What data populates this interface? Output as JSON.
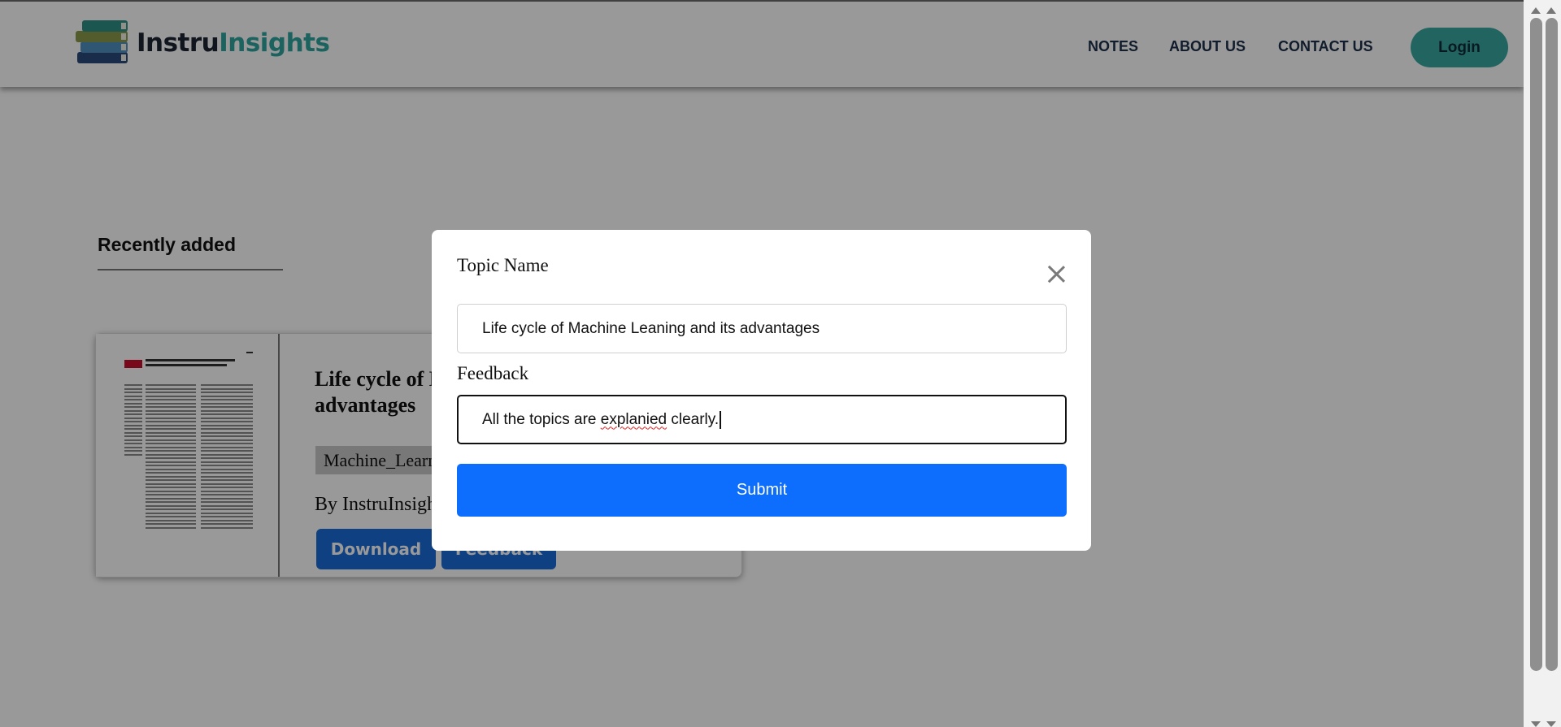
{
  "brand": {
    "name_part1": "Instru",
    "name_part2": "Insights"
  },
  "nav": {
    "notes": "NOTES",
    "about": "ABOUT US",
    "contact": "CONTACT US",
    "login": "Login"
  },
  "main": {
    "section_title": "Recently added",
    "card": {
      "title": "Life cycle of Machine Leaning and its advantages",
      "tag": "Machine_Learning",
      "author": "By InstruInsights",
      "download_label": "Download",
      "feedback_label": "Feedback"
    }
  },
  "modal": {
    "topic_label": "Topic Name",
    "topic_value": "Life cycle of Machine Leaning and its advantages",
    "feedback_label": "Feedback",
    "feedback_value_pre": "All the topics are ",
    "feedback_value_misspelled": "explanied",
    "feedback_value_post": " clearly.",
    "submit_label": "Submit"
  },
  "colors": {
    "brand_teal": "#2fa69e",
    "login_bg": "#3aa8a0",
    "primary_blue": "#0d6efd",
    "card_button_blue": "#1a6cd8"
  },
  "icons": {
    "close": "close-icon",
    "logo": "books-logo-icon"
  }
}
